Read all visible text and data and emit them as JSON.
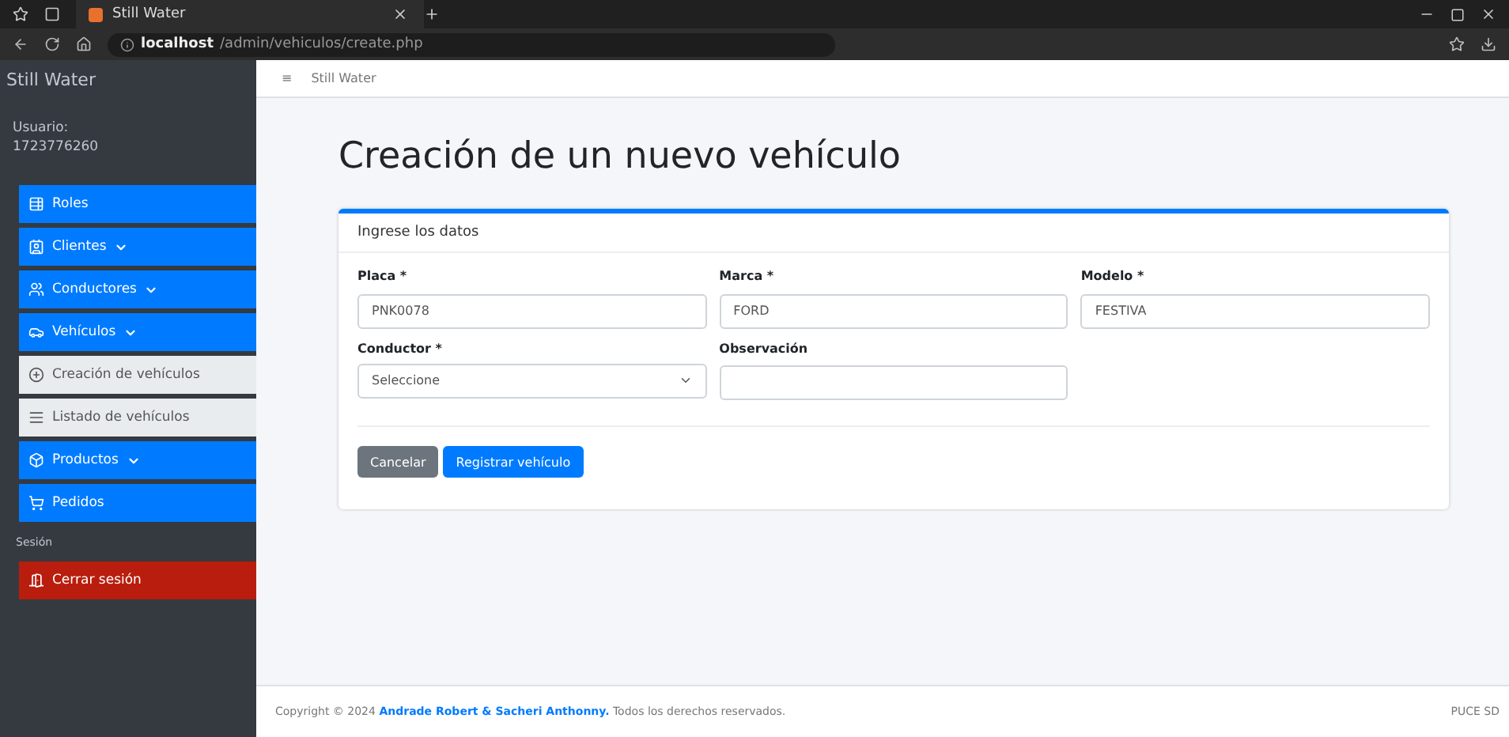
{
  "browser": {
    "tab_title": "Still Water",
    "url_host": "localhost",
    "url_path": "/admin/vehiculos/create.php"
  },
  "sidebar": {
    "brand": "Still Water",
    "user_label": "Usuario:",
    "user_id": "1723776260",
    "items": [
      {
        "label": "Roles",
        "kind": "link"
      },
      {
        "label": "Clientes",
        "kind": "dropdown"
      },
      {
        "label": "Conductores",
        "kind": "dropdown"
      },
      {
        "label": "Vehículos",
        "kind": "dropdown"
      },
      {
        "label": "Creación de vehículos",
        "kind": "subitem"
      },
      {
        "label": "Listado de vehículos",
        "kind": "subitem"
      },
      {
        "label": "Productos",
        "kind": "dropdown"
      },
      {
        "label": "Pedidos",
        "kind": "link"
      }
    ],
    "section_label": "Sesión",
    "logout": "Cerrar sesión"
  },
  "topbar": {
    "menu_glyph": "≡",
    "title": "Still Water"
  },
  "page_title": "Creación de un nuevo vehículo",
  "card": {
    "header": "Ingrese los datos",
    "fields": [
      {
        "label": "Placa *",
        "value": "PNK0078",
        "kind": "input"
      },
      {
        "label": "Marca *",
        "value": "FORD",
        "kind": "input"
      },
      {
        "label": "Modelo *",
        "value": "FESTIVA",
        "kind": "input"
      },
      {
        "label": "Conductor *",
        "value": "Seleccione",
        "kind": "select"
      },
      {
        "label": "Observación",
        "kind": "input"
      }
    ],
    "buttons": [
      {
        "label": "Cancelar",
        "kind": "secondary"
      },
      {
        "label": "Registrar vehículo",
        "kind": "primary"
      }
    ]
  },
  "footer": {
    "text": "Copyright © 2024 **Andrade Robert & Sacheri Anthonny.** Todos los derechos reservados.",
    "version": "PUCE SD"
  }
}
